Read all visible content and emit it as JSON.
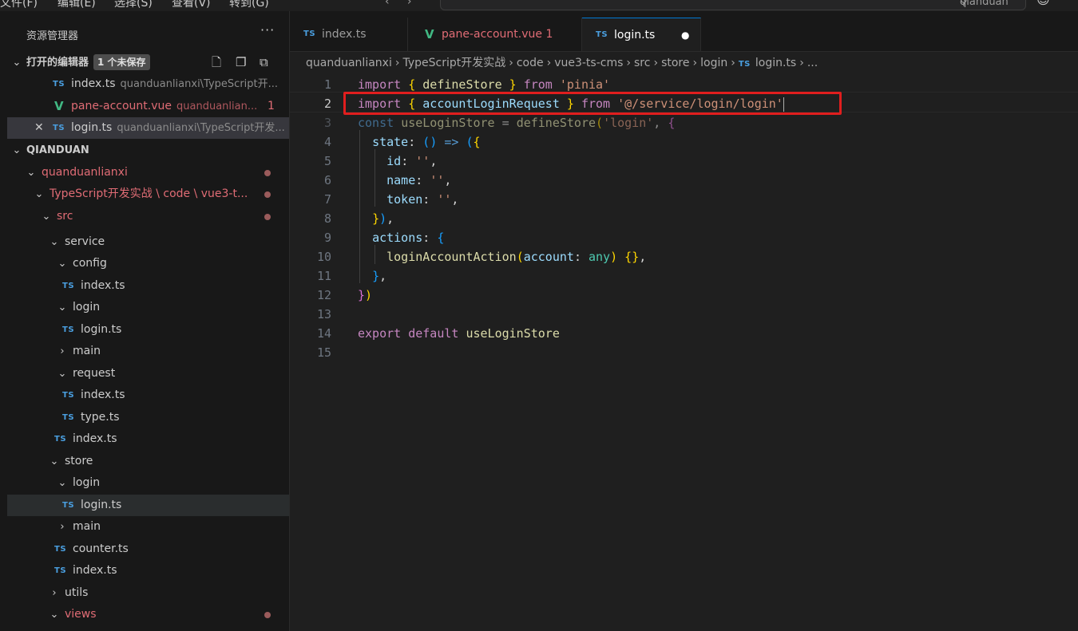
{
  "titlebar": {
    "menus": [
      "文件(F)",
      "编辑(E)",
      "选择(S)",
      "查看(V)",
      "转到(G)"
    ],
    "search": "qianduan"
  },
  "sidebar": {
    "title": "资源管理器",
    "more": "···",
    "open_editors": {
      "label": "打开的编辑器",
      "badge": "1 个未保存",
      "items": [
        {
          "icon": "TS",
          "name": "index.ts",
          "desc": "quanduanlianxi\\TypeScript开..."
        },
        {
          "icon": "V",
          "name": "pane-account.vue",
          "desc": "quanduanlian...",
          "count": "1"
        },
        {
          "icon": "TS",
          "name": "login.ts",
          "desc": "quanduanlianxi\\TypeScript开发...",
          "close": "✕"
        }
      ]
    },
    "workspace": "QIANDUAN",
    "tree": [
      {
        "label": "quanduanlianxi"
      },
      {
        "label": "TypeScript开发实战 \\ code \\ vue3-t..."
      },
      {
        "label": "src"
      },
      {
        "label": "service"
      },
      {
        "label": "config"
      },
      {
        "label": "index.ts"
      },
      {
        "label": "login"
      },
      {
        "label": "login.ts"
      },
      {
        "label": "main"
      },
      {
        "label": "request"
      },
      {
        "label": "index.ts"
      },
      {
        "label": "type.ts"
      },
      {
        "label": "index.ts"
      },
      {
        "label": "store"
      },
      {
        "label": "login"
      },
      {
        "label": "login.ts"
      },
      {
        "label": "main"
      },
      {
        "label": "counter.ts"
      },
      {
        "label": "index.ts"
      },
      {
        "label": "utils"
      },
      {
        "label": "views"
      }
    ]
  },
  "tabs": [
    {
      "icon": "TS",
      "label": "index.ts"
    },
    {
      "icon": "V",
      "label": "pane-account.vue",
      "count": "1"
    },
    {
      "icon": "TS",
      "label": "login.ts",
      "dirty": "●"
    }
  ],
  "breadcrumb": [
    "quanduanlianxi",
    "TypeScript开发实战",
    "code",
    "vue3-ts-cms",
    "src",
    "store",
    "login",
    "login.ts",
    "..."
  ],
  "editor": {
    "line_numbers": [
      "1",
      "2",
      "3",
      "4",
      "5",
      "6",
      "7",
      "8",
      "9",
      "10",
      "11",
      "12",
      "13",
      "14",
      "15"
    ],
    "lines": [
      "import { defineStore } from 'pinia'",
      "import { accountLoginRequest } from '@/service/login/login'",
      "const useLoginStore = defineStore('login', {",
      "  state: () => ({",
      "    id: '',",
      "    name: '',",
      "    token: '',",
      "  }),",
      "  actions: {",
      "    loginAccountAction(account: any) {},",
      "  },",
      "})",
      "",
      "export default useLoginStore",
      ""
    ]
  },
  "colors": {
    "accent": "#0078d4",
    "highlight_box": "#e01e1e",
    "modified_text": "#e06c75"
  }
}
